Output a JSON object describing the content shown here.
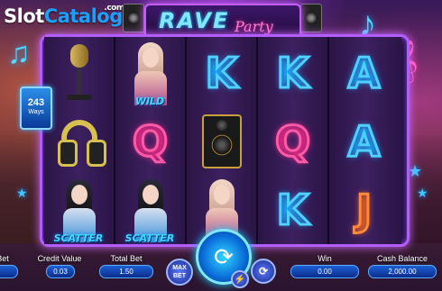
{
  "branding": {
    "logo_slot": "Slot",
    "logo_catalog": "Catalog",
    "logo_com": ".com"
  },
  "title": {
    "word1": "RAVE",
    "word2": "Party"
  },
  "ways_badge": {
    "number": "243",
    "label": "Ways"
  },
  "reels": [
    [
      "microphone",
      "headphones",
      "girl_scatter"
    ],
    [
      "girl_wild",
      "Q",
      "girl_scatter"
    ],
    [
      "K",
      "speaker",
      "girl_blonde"
    ],
    [
      "K",
      "Q",
      "K"
    ],
    [
      "A",
      "A",
      "J"
    ]
  ],
  "symbol_badges": {
    "wild": "WILD",
    "scatter": "SCATTER"
  },
  "hud": {
    "bet_label": "Bet",
    "credit_value_label": "Credit Value",
    "credit_value": "0.03",
    "total_bet_label": "Total Bet",
    "total_bet": "1.50",
    "max_bet_label_1": "MAX",
    "max_bet_label_2": "BET",
    "win_label": "Win",
    "win": "0.00",
    "cash_balance_label": "Cash Balance",
    "cash_balance": "2,000.00"
  },
  "colors": {
    "frame": "#b45dff",
    "accent_blue": "#3fc6ff",
    "accent_pink": "#ff5aa8",
    "hud_blue": "#1c5fd6"
  }
}
